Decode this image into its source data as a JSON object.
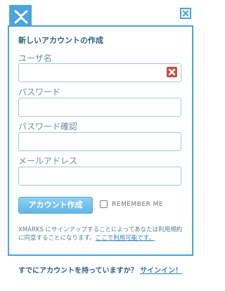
{
  "logo": {
    "icon": "xmarks-logo-icon",
    "color": "#4aa5d8"
  },
  "close": {
    "icon": "close-icon"
  },
  "form": {
    "title": "新しいアカウントの作成",
    "username_label": "ユーザ名",
    "username_value": "",
    "password_label": "パスワード",
    "password_value": "",
    "password_confirm_label": "パスワード確認",
    "password_confirm_value": "",
    "email_label": "メールアドレス",
    "email_value": "",
    "create_button": "アカウント作成",
    "remember_label": "REMEMBER ME",
    "remember_checked": false,
    "terms_text": "XMARKS にサインアップすることによってあなたは利用規約に同意することになります。",
    "terms_link": "ここで利用可能です。"
  },
  "footer": {
    "prompt": "すでにアカウントを持っていますか？ ",
    "signin_link": "サインイン！"
  },
  "colors": {
    "accent": "#4aa5d8",
    "title": "#2f5f7f",
    "error": "#c94c4c"
  }
}
